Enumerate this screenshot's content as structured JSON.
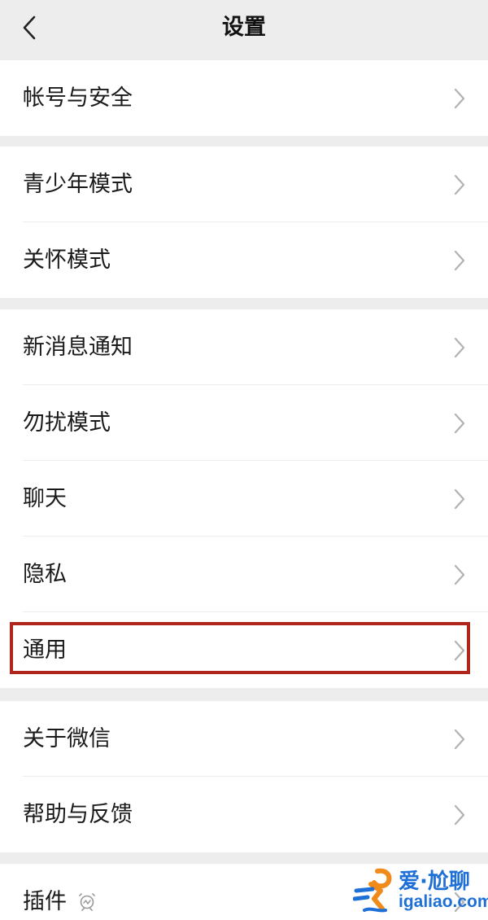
{
  "nav": {
    "title": "设置"
  },
  "groups": [
    {
      "items": [
        {
          "label": "帐号与安全"
        }
      ]
    },
    {
      "items": [
        {
          "label": "青少年模式"
        },
        {
          "label": "关怀模式"
        }
      ]
    },
    {
      "items": [
        {
          "label": "新消息通知"
        },
        {
          "label": "勿扰模式"
        },
        {
          "label": "聊天"
        },
        {
          "label": "隐私"
        },
        {
          "label": "通用"
        }
      ]
    },
    {
      "items": [
        {
          "label": "关于微信"
        },
        {
          "label": "帮助与反馈"
        }
      ]
    },
    {
      "items": [
        {
          "label": "插件"
        }
      ]
    }
  ],
  "watermark": {
    "brand": "爱·尬聊",
    "url": "igaliao.com"
  },
  "colors": {
    "background": "#ededed",
    "card": "#ffffff",
    "highlight": "#b0251c",
    "watermark": "#1e6fd6"
  }
}
